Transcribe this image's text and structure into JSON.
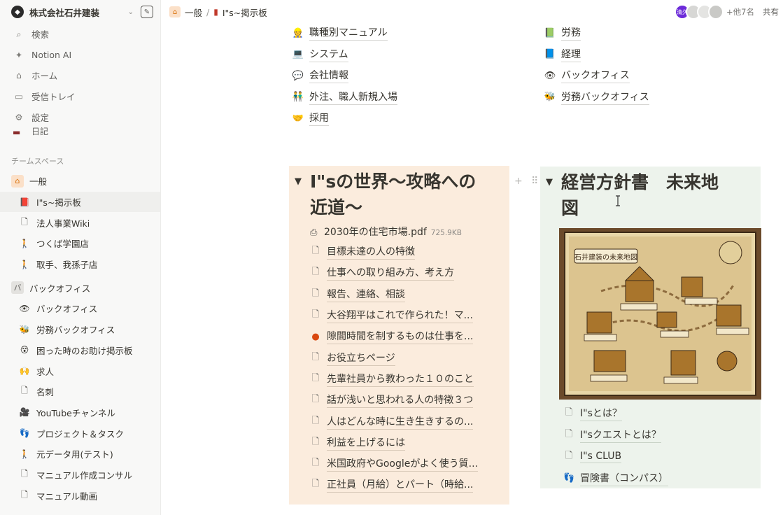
{
  "workspace": {
    "name": "株式会社石井建装"
  },
  "sidebar": {
    "nav": [
      {
        "label": "検索",
        "icon": "search-icon",
        "glyph": "⌕"
      },
      {
        "label": "Notion AI",
        "icon": "ai-sparkle-icon",
        "glyph": "✦"
      },
      {
        "label": "ホーム",
        "icon": "home-icon",
        "glyph": "⌂"
      },
      {
        "label": "受信トレイ",
        "icon": "inbox-icon",
        "glyph": "▭"
      },
      {
        "label": "設定",
        "icon": "settings-icon",
        "glyph": "⚙"
      }
    ],
    "cut_item": "日記",
    "section_label": "チームスペース",
    "teamspace": {
      "label": "一般",
      "items": [
        {
          "label": "I\"s~掲示板",
          "glyph": "📕",
          "active": true
        },
        {
          "label": "法人事業Wiki",
          "glyph": "🗋"
        },
        {
          "label": "つくば学園店",
          "glyph": "🚶"
        },
        {
          "label": "取手、我孫子店",
          "glyph": "🚶"
        }
      ]
    },
    "backoffice": {
      "label": "バックオフィス",
      "badge": "バ",
      "items": [
        {
          "label": "バックオフィス",
          "glyph": "👁"
        },
        {
          "label": "労務バックオフィス",
          "glyph": "🐝"
        },
        {
          "label": "困った時のお助け掲示板",
          "glyph": "😵"
        },
        {
          "label": "求人",
          "glyph": "🙌"
        },
        {
          "label": "名刺",
          "glyph": "🗋"
        },
        {
          "label": "YouTubeチャンネル",
          "glyph": "🎥"
        },
        {
          "label": "プロジェクト＆タスク",
          "glyph": "👣"
        },
        {
          "label": "元データ用(テスト)",
          "glyph": "🚶"
        },
        {
          "label": "マニュアル作成コンサル",
          "glyph": "🗋"
        },
        {
          "label": "マニュアル動画",
          "glyph": "🗋"
        }
      ]
    }
  },
  "breadcrumb": {
    "first": "一般",
    "separator": "/",
    "second": "I\"s~掲示板"
  },
  "topbar": {
    "avatar_label": "清久",
    "others": "+他7名",
    "share": "共有"
  },
  "links_left": [
    {
      "label": "職種別マニュアル",
      "glyph": "👷"
    },
    {
      "label": "システム",
      "glyph": "💻"
    },
    {
      "label": "会社情報",
      "glyph": "💬"
    },
    {
      "label": "外注、職人新規入場",
      "glyph": "👬"
    },
    {
      "label": "採用",
      "glyph": "🤝"
    }
  ],
  "links_right": [
    {
      "label": "労務",
      "glyph": "📗"
    },
    {
      "label": "経理",
      "glyph": "📘"
    },
    {
      "label": "バックオフィス",
      "glyph": "👁"
    },
    {
      "label": "労務バックオフィス",
      "glyph": "🐝"
    }
  ],
  "left_column": {
    "title_line1": "I\"sの世界〜攻略への",
    "title_line2": "近道〜",
    "file": {
      "name": "2030年の住宅市場.pdf",
      "size": "725.9KB"
    },
    "pages": [
      {
        "label": "目標未達の人の特徴",
        "glyph": "🗋"
      },
      {
        "label": "仕事への取り組み方、考え方",
        "glyph": "🗋"
      },
      {
        "label": "報告、連絡、相談",
        "glyph": "🗋"
      },
      {
        "label": "大谷翔平はこれで作られた！マ...",
        "glyph": "🗋"
      },
      {
        "label": "隙間時間を制するものは仕事を...",
        "glyph": "●"
      },
      {
        "label": "お役立ちページ",
        "glyph": "🗋"
      },
      {
        "label": "先輩社員から教わった１０のこと",
        "glyph": "🗋"
      },
      {
        "label": "話が浅いと思われる人の特徴３つ",
        "glyph": "🗋"
      },
      {
        "label": "人はどんな時に生き生きするの...",
        "glyph": "🗋"
      },
      {
        "label": "利益を上げるには",
        "glyph": "🗋"
      },
      {
        "label": "米国政府やGoogleがよく使う質...",
        "glyph": "🗋"
      },
      {
        "label": "正社員（月給）とパート（時給...",
        "glyph": "🗋"
      }
    ]
  },
  "right_column": {
    "title_line1": "経営方針書　未来地",
    "title_line2": "図",
    "map": {
      "banner": "石井建装の未来地図"
    },
    "pages": [
      {
        "label": "I\"sとは？",
        "glyph": "🗋"
      },
      {
        "label": "I\"sクエストとは？",
        "glyph": "🗋"
      },
      {
        "label": "I\"s CLUB",
        "glyph": "🗋"
      },
      {
        "label": "冒険書（コンパス）",
        "glyph": "👣"
      }
    ]
  },
  "colors": {
    "left_column_bg": "#fbecdd",
    "right_column_bg": "#edf3ec",
    "sidebar_bg": "#f8f8f7",
    "avatar_purple": "#6c2bd9"
  }
}
